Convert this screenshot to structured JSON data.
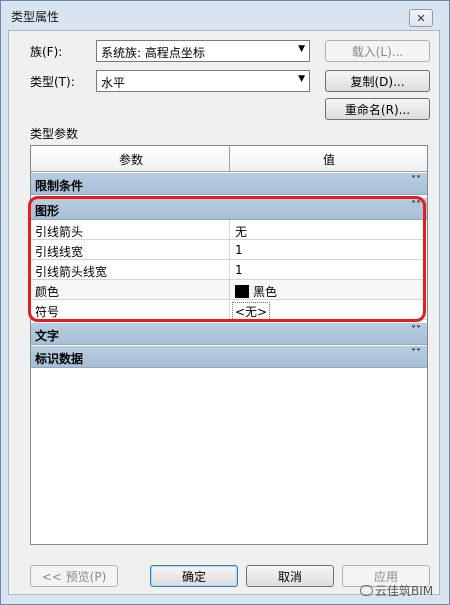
{
  "window": {
    "title": "类型属性",
    "close_symbol": "✕"
  },
  "family": {
    "label": "族(F):",
    "value": "系统族: 高程点坐标",
    "load_button": "载入(L)..."
  },
  "type": {
    "label": "类型(T):",
    "value": "水平",
    "duplicate_button": "复制(D)...",
    "rename_button": "重命名(R)..."
  },
  "section_title": "类型参数",
  "table": {
    "columns": [
      "参数",
      "值"
    ],
    "groups": [
      {
        "name": "限制条件",
        "collapsed": true,
        "chevron": "˅˅"
      },
      {
        "name": "图形",
        "collapsed": false,
        "chevron": "˄˄",
        "rows": [
          {
            "param": "引线箭头",
            "value": "无"
          },
          {
            "param": "引线线宽",
            "value": "1"
          },
          {
            "param": "引线箭头线宽",
            "value": "1"
          },
          {
            "param": "颜色",
            "value": "黑色",
            "swatch": "#000000"
          },
          {
            "param": "符号",
            "value": "<无>"
          }
        ]
      },
      {
        "name": "文字",
        "collapsed": true,
        "chevron": "˅˅"
      },
      {
        "name": "标识数据",
        "collapsed": true,
        "chevron": "˅˅"
      }
    ]
  },
  "footer": {
    "preview_button": "<< 预览(P)",
    "ok_button": "确定",
    "cancel_button": "取消",
    "apply_button": "应用"
  },
  "watermark": "云佳筑BIM",
  "colors": {
    "highlight": "#e51d1d",
    "group_header": "#a7bfd6"
  },
  "icons": {
    "dropdown": "chevron-down-icon",
    "close": "close-icon"
  }
}
